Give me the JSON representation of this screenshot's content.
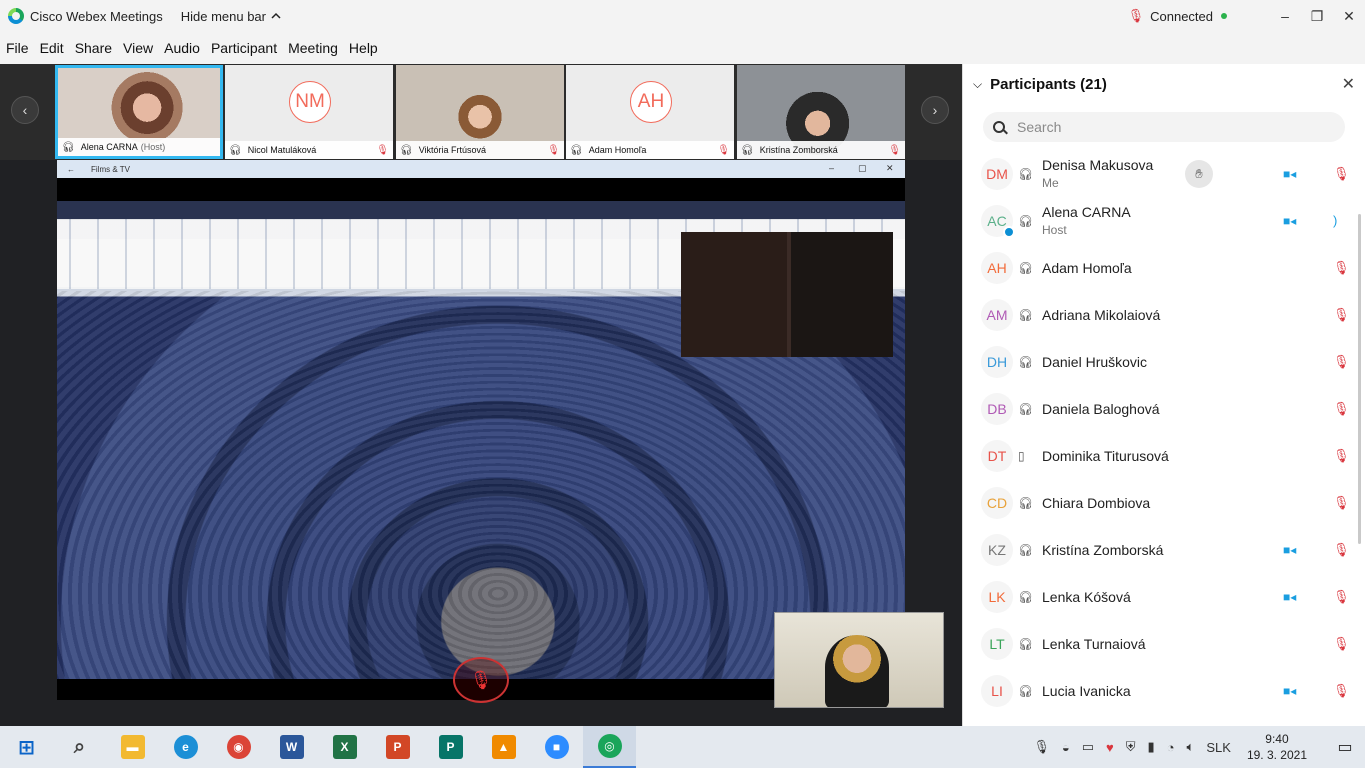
{
  "titlebar": {
    "app_title": "Cisco Webex Meetings",
    "hide_menu": "Hide menu bar",
    "hide_menu_icon": "chevron-up-icon",
    "status": "Connected",
    "status_color": "#2bb24c",
    "minimize": "–",
    "restore": "❐",
    "close": "✕"
  },
  "menubar": {
    "items": [
      "File",
      "Edit",
      "Share",
      "View",
      "Audio",
      "Participant",
      "Meeting",
      "Help"
    ]
  },
  "thumbnails": [
    {
      "name": "Alena CARNA",
      "tag": "(Host)",
      "initials": "",
      "video": true,
      "muted": false,
      "active": true
    },
    {
      "name": "Nicol Matuláková",
      "tag": "",
      "initials": "NM",
      "video": false,
      "muted": true,
      "active": false
    },
    {
      "name": "Viktória Frtúsová",
      "tag": "",
      "initials": "",
      "video": true,
      "muted": true,
      "active": false
    },
    {
      "name": "Adam Homoľa",
      "tag": "",
      "initials": "AH",
      "video": false,
      "muted": true,
      "active": false
    },
    {
      "name": "Kristína Zomborská",
      "tag": "",
      "initials": "",
      "video": true,
      "muted": true,
      "active": false
    }
  ],
  "share": {
    "app_name": "Films & TV",
    "back": "←",
    "min": "–",
    "max": "▢",
    "close": "✕"
  },
  "panel": {
    "title": "Participants (21)",
    "close": "✕",
    "search_placeholder": "Search",
    "participants": [
      {
        "initials": "DM",
        "color": "#e8534a",
        "device": "headset",
        "name": "Denisa Makusova",
        "sub": "Me",
        "raised": true,
        "video": true,
        "mic": "muted"
      },
      {
        "initials": "AC",
        "color": "#5bb08a",
        "device": "headset",
        "name": "Alena CARNA",
        "sub": "Host",
        "raised": false,
        "video": true,
        "mic": "speaking",
        "host_badge": true
      },
      {
        "initials": "AH",
        "color": "#f26b3a",
        "device": "headset",
        "name": "Adam Homoľa",
        "sub": "",
        "raised": false,
        "video": false,
        "mic": "muted"
      },
      {
        "initials": "AM",
        "color": "#b05ab5",
        "device": "headset",
        "name": "Adriana Mikolaiová",
        "sub": "",
        "raised": false,
        "video": false,
        "mic": "muted"
      },
      {
        "initials": "DH",
        "color": "#3a9ad9",
        "device": "headset",
        "name": "Daniel Hruškovic",
        "sub": "",
        "raised": false,
        "video": false,
        "mic": "muted"
      },
      {
        "initials": "DB",
        "color": "#b05ab5",
        "device": "headset",
        "name": "Daniela Baloghová",
        "sub": "",
        "raised": false,
        "video": false,
        "mic": "muted"
      },
      {
        "initials": "DT",
        "color": "#e8534a",
        "device": "phone",
        "name": "Dominika Titurusová",
        "sub": "",
        "raised": false,
        "video": false,
        "mic": "muted"
      },
      {
        "initials": "CD",
        "color": "#e8a23a",
        "device": "headset",
        "name": "Chiara Dombiova",
        "sub": "",
        "raised": false,
        "video": false,
        "mic": "muted"
      },
      {
        "initials": "KZ",
        "color": "#777777",
        "device": "headset",
        "name": "Kristína Zomborská",
        "sub": "",
        "raised": false,
        "video": true,
        "mic": "muted"
      },
      {
        "initials": "LK",
        "color": "#f26b3a",
        "device": "headset",
        "name": "Lenka Kóšová",
        "sub": "",
        "raised": false,
        "video": true,
        "mic": "muted"
      },
      {
        "initials": "LT",
        "color": "#3aa55a",
        "device": "headset",
        "name": "Lenka Turnaiová",
        "sub": "",
        "raised": false,
        "video": false,
        "mic": "muted"
      },
      {
        "initials": "LI",
        "color": "#e8534a",
        "device": "headset",
        "name": "Lucia Ivanicka",
        "sub": "",
        "raised": false,
        "video": true,
        "mic": "muted"
      }
    ]
  },
  "taskbar": {
    "apps": [
      {
        "name": "start",
        "glyph": "⊞",
        "color": "#0a64c8"
      },
      {
        "name": "search",
        "glyph": "⌕",
        "color": "#444444"
      },
      {
        "name": "file-explorer",
        "glyph": "▬",
        "color": "#f2b931"
      },
      {
        "name": "edge",
        "glyph": "e",
        "color": "#1c8fd6"
      },
      {
        "name": "chrome",
        "glyph": "◉",
        "color": "#db4437"
      },
      {
        "name": "word",
        "glyph": "W",
        "color": "#2b579a"
      },
      {
        "name": "excel",
        "glyph": "X",
        "color": "#217346"
      },
      {
        "name": "powerpoint",
        "glyph": "P",
        "color": "#d24726"
      },
      {
        "name": "publisher",
        "glyph": "P",
        "color": "#077568"
      },
      {
        "name": "vlc",
        "glyph": "▲",
        "color": "#f08a00"
      },
      {
        "name": "zoom",
        "glyph": "■",
        "color": "#2d8cff"
      },
      {
        "name": "webex",
        "glyph": "◎",
        "color": "#1aa55a"
      }
    ],
    "language": "SLK",
    "time": "9:40",
    "date": "19. 3. 2021"
  }
}
